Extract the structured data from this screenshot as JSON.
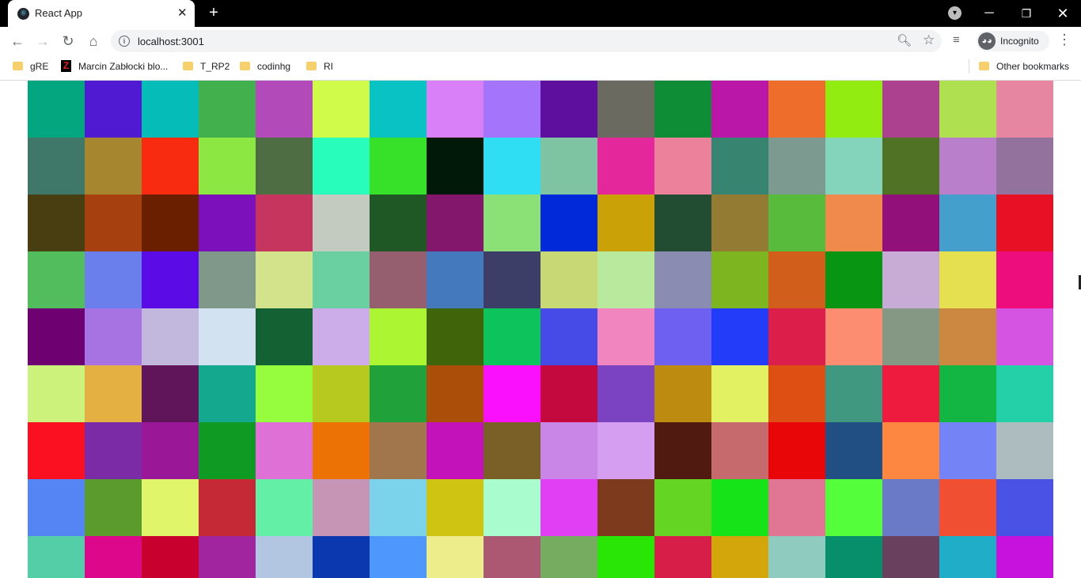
{
  "browser": {
    "tab": {
      "title": "React App",
      "favicon_icon": "react-logo-icon"
    },
    "address": {
      "url": "localhost:3001"
    },
    "profile": {
      "label": "Incognito"
    },
    "bookmarks": [
      {
        "label": "gRE",
        "icon": "folder-icon"
      },
      {
        "label": "Marcin Zabłocki blo...",
        "icon": "site-favicon-icon"
      },
      {
        "label": "T_RP2",
        "icon": "folder-icon"
      },
      {
        "label": "codinhg",
        "icon": "folder-icon"
      },
      {
        "label": "RI",
        "icon": "folder-icon"
      }
    ],
    "other_bookmarks": "Other bookmarks"
  },
  "page": {
    "columns": 18,
    "rows": [
      [
        "#03a67f",
        "#4f1ad1",
        "#05bcb8",
        "#42b14d",
        "#b24ab9",
        "#d0fb4b",
        "#09c2c3",
        "#d97ff7",
        "#a475fa",
        "#5f0f9d",
        "#6a6a60",
        "#0f8c36",
        "#ba17a8",
        "#ee6d2a",
        "#93ec11",
        "#ac428f",
        "#afe050",
        "#e786a0"
      ],
      [
        "#3f7868",
        "#a6862e",
        "#f82b11",
        "#8ce743",
        "#4f6d43",
        "#28fdbb",
        "#37e12a",
        "#001909",
        "#30def4",
        "#7ec4a2",
        "#e4289c",
        "#ec819c",
        "#378470",
        "#7c9a90",
        "#84d4bb",
        "#507224",
        "#b97fcb",
        "#93739d"
      ],
      [
        "#493e11",
        "#a6410f",
        "#6a2000",
        "#7c10bb",
        "#c6355d",
        "#c3cbc0",
        "#1f5725",
        "#82176c",
        "#8be076",
        "#0128d9",
        "#caa207",
        "#224d33",
        "#937b33",
        "#58bb3b",
        "#f08a4c",
        "#91107a",
        "#459fcc",
        "#e71024"
      ],
      [
        "#51bd5c",
        "#6b7fec",
        "#5b0be6",
        "#7f9889",
        "#d3e38c",
        "#6acfa1",
        "#955f70",
        "#4579be",
        "#3c3e68",
        "#c7d875",
        "#b9e99c",
        "#8a8cb2",
        "#7cb520",
        "#d25e1b",
        "#089512",
        "#c9acd6",
        "#e4e04f",
        "#ee0d7c"
      ],
      [
        "#6f0072",
        "#a772e1",
        "#c2b7dd",
        "#d2e2f0",
        "#146233",
        "#ccade9",
        "#acf532",
        "#406409",
        "#0cc45b",
        "#464be7",
        "#f185c0",
        "#6e61f1",
        "#223cfa",
        "#dc1e4a",
        "#fc8d70",
        "#849883",
        "#cc8841",
        "#d654e2"
      ],
      [
        "#cdf27b",
        "#e4b042",
        "#60155a",
        "#14a88f",
        "#96fd3e",
        "#b7c81e",
        "#21a139",
        "#ab4e0a",
        "#fa10fc",
        "#c4093e",
        "#7b43c1",
        "#bd8b10",
        "#e2f161",
        "#de4f14",
        "#409880",
        "#ee1b3e",
        "#14b643",
        "#23d0a7"
      ],
      [
        "#fb1021",
        "#7c2ba6",
        "#9a1797",
        "#0f9a23",
        "#df70d6",
        "#ed7205",
        "#a2764c",
        "#c412ba",
        "#7a6027",
        "#ca86e6",
        "#d59ef0",
        "#511a11",
        "#c76a6e",
        "#e80608",
        "#224f83",
        "#fd8641",
        "#7484f7",
        "#adbcbe"
      ],
      [
        "#5585f5",
        "#5b9b2d",
        "#e1f56b",
        "#c52935",
        "#63f0a6",
        "#c694b4",
        "#7ad3ea",
        "#cfc412",
        "#a8fccd",
        "#e03ff4",
        "#7d3a1d",
        "#65d524",
        "#17e319",
        "#e07594",
        "#55fe3b",
        "#6a7ac7",
        "#f04f31",
        "#4a51e5"
      ],
      [
        "#54cea6",
        "#dc078b",
        "#c7002e",
        "#a1259f",
        "#b2c6e1",
        "#0b38ae",
        "#4d97fd",
        "#edee8b",
        "#ad5872",
        "#76ac5f",
        "#29e607",
        "#d71e48",
        "#d3a60b",
        "#90cbbf",
        "#078f6c",
        "#6a405f",
        "#1fadc7",
        "#c712de"
      ]
    ]
  }
}
